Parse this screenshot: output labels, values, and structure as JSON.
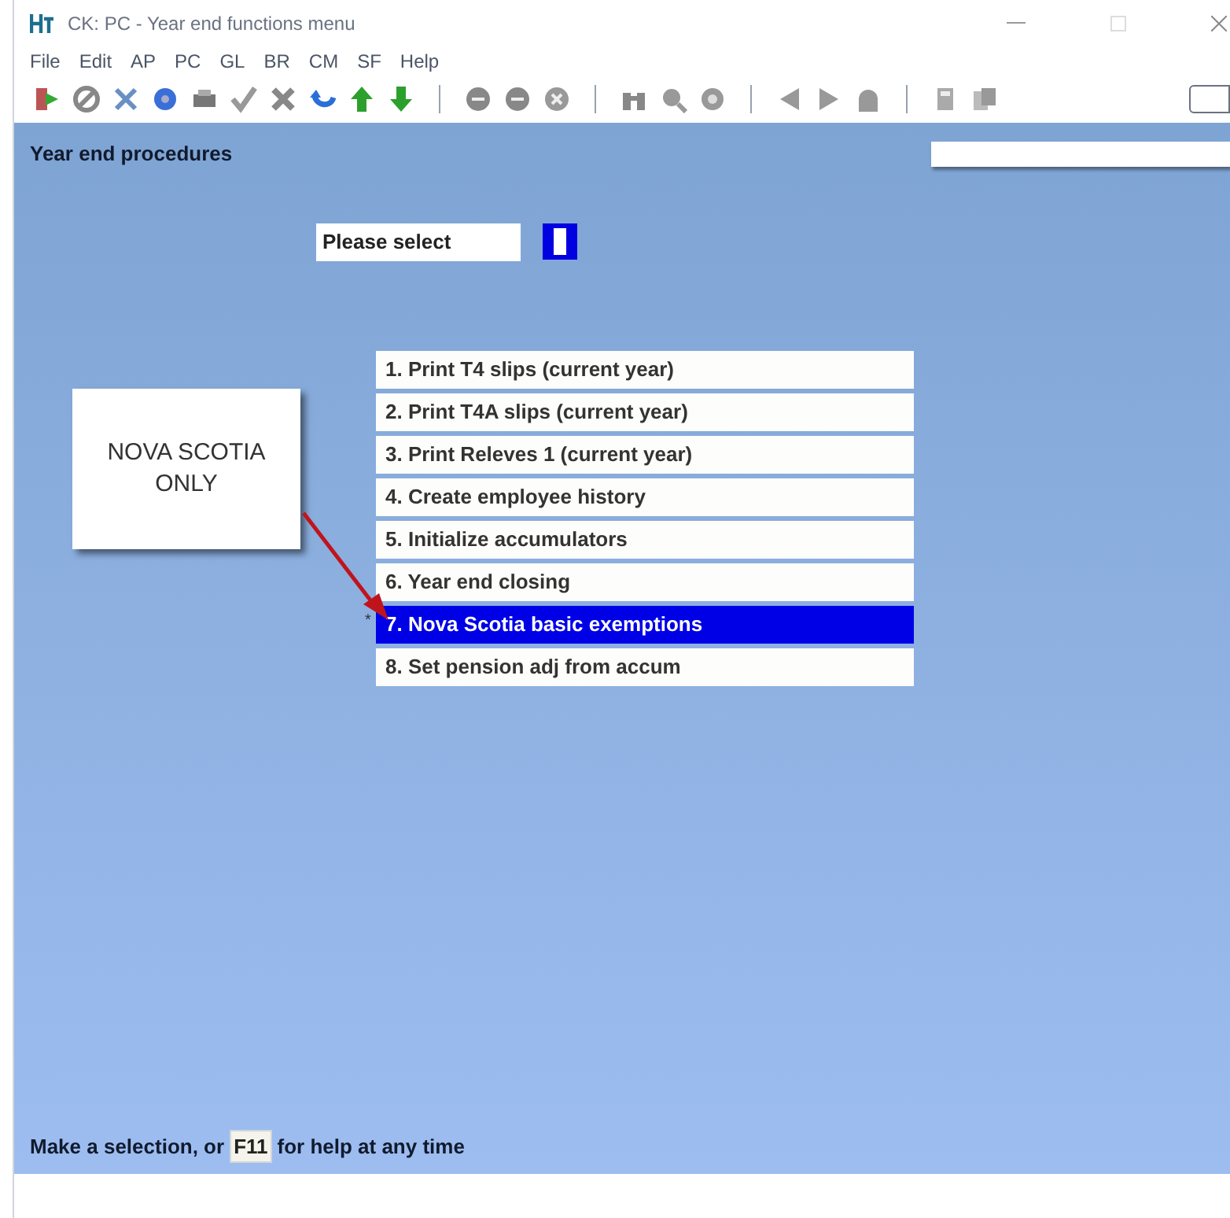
{
  "window": {
    "title": "CK: PC - Year end functions menu"
  },
  "menu": [
    "File",
    "Edit",
    "AP",
    "PC",
    "GL",
    "BR",
    "CM",
    "SF",
    "Help"
  ],
  "screen": {
    "heading": "Year end procedures",
    "prompt": "Please select",
    "options": [
      {
        "label": "1. Print T4 slips (current year)",
        "selected": false
      },
      {
        "label": "2. Print T4A slips (current year)",
        "selected": false
      },
      {
        "label": "3. Print Releves 1 (current year)",
        "selected": false
      },
      {
        "label": "4. Create employee history",
        "selected": false
      },
      {
        "label": "5. Initialize accumulators",
        "selected": false
      },
      {
        "label": "6. Year end closing",
        "selected": false
      },
      {
        "label": "7. Nova Scotia basic exemptions",
        "selected": true,
        "marker": "*"
      },
      {
        "label": "8. Set pension adj from accum",
        "selected": false
      }
    ],
    "callout": "NOVA SCOTIA ONLY"
  },
  "status_bar": {
    "before": "Make a selection, or",
    "key": "F11",
    "after": "for help at any time"
  }
}
